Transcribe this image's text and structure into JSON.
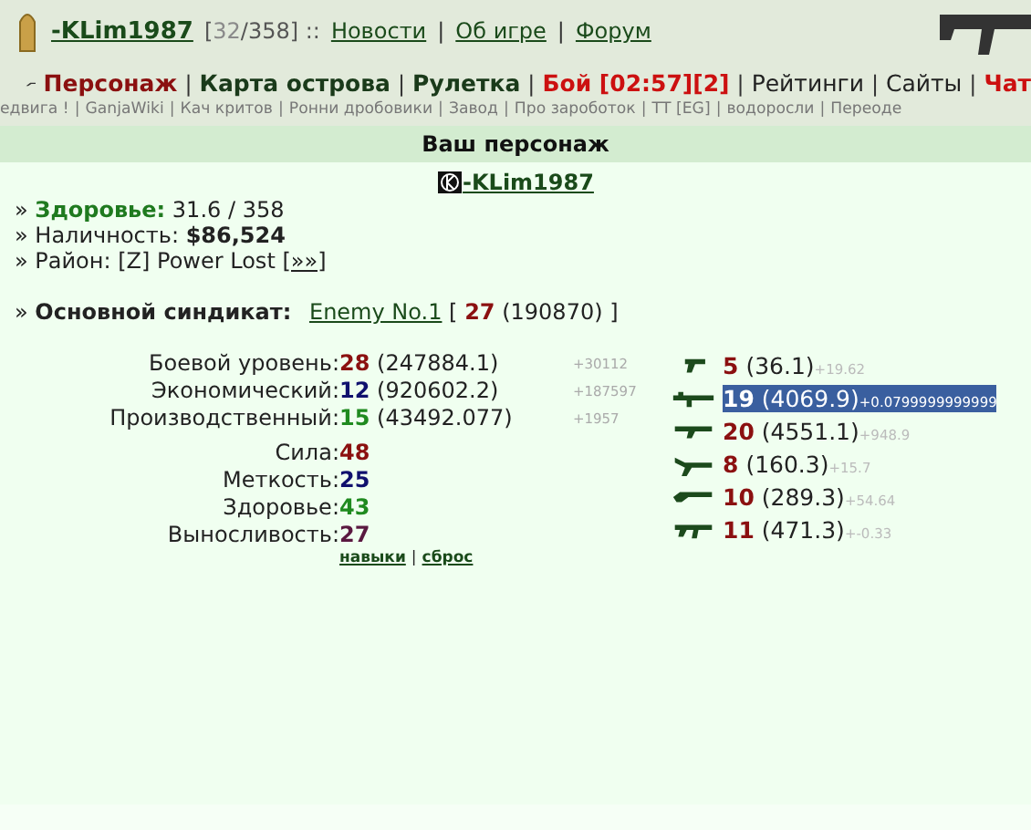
{
  "header": {
    "username": "-KLim1987",
    "hp_open": "[",
    "hp_current": "32",
    "hp_rest": "/358] ::",
    "links": [
      "Новости",
      "Об игре",
      "Форум"
    ],
    "separators": [
      "|",
      "|"
    ]
  },
  "nav_separators": [
    "|",
    "|",
    "|",
    "|",
    "|",
    "|"
  ],
  "sub_separators": [
    "|",
    "|",
    "|",
    "|",
    "|",
    "|",
    "|",
    "|"
  ],
  "bullets": [
    "»",
    "»",
    "»",
    "»"
  ],
  "nav": [
    {
      "label": "Персонаж",
      "kind": "active"
    },
    {
      "label": "Карта острова",
      "kind": "main"
    },
    {
      "label": "Рулетка",
      "kind": "main"
    },
    {
      "label": "Бой [02:57][2]",
      "kind": "alert"
    },
    {
      "label": "Рейтинги",
      "kind": "plain"
    },
    {
      "label": "Сайты",
      "kind": "plain"
    },
    {
      "label": "Чат",
      "kind": "alert"
    }
  ],
  "sublinks": [
    "едвига !",
    "GanjaWiki",
    "Кач критов",
    "Ронни дробовики",
    "Завод",
    "Про зароботок",
    "ТТ [EG]",
    "водоросли",
    "Переоде"
  ],
  "section_title": "Ваш персонаж",
  "character": {
    "name": "-KLim1987",
    "health_label": "Здоровье:",
    "health": "31.6 / 358",
    "cash_label": "Наличность:",
    "cash": "$86,524",
    "district_label": "Район:",
    "district": "[Z] Power Lost",
    "district_link": "[»»]",
    "syndicate_label": "Основной синдикат:",
    "syndicate": "Enemy No.1",
    "syndicate_open": "[",
    "syndicate_level": "27",
    "syndicate_points": "(190870) ]"
  },
  "levels": [
    {
      "label": "Боевой уровень:",
      "value": "28",
      "points": "(247884.1)",
      "delta": "+30112",
      "color": "#8b1010"
    },
    {
      "label": "Экономический:",
      "value": "12",
      "points": "(920602.2)",
      "delta": "+187597",
      "color": "#10106e"
    },
    {
      "label": "Производственный:",
      "value": "15",
      "points": "(43492.077)",
      "delta": "+1957",
      "color": "#1f8a1f"
    }
  ],
  "skills": [
    {
      "label": "Сила:",
      "value": "48",
      "color": "#8b1010"
    },
    {
      "label": "Меткость:",
      "value": "25",
      "color": "#10106e"
    },
    {
      "label": "Здоровье:",
      "value": "43",
      "color": "#1f8a1f"
    },
    {
      "label": "Выносливость:",
      "value": "27",
      "color": "#5a1840"
    }
  ],
  "skill_links": [
    "навыки",
    "сброс"
  ],
  "skill_separator": "|",
  "weapons": [
    {
      "kind": "pistol",
      "level": "5",
      "points": "(36.1)",
      "delta": "+19.62",
      "selected": false
    },
    {
      "kind": "launcher",
      "level": "19",
      "points": "(4069.9)",
      "delta": "+0.0799999999999",
      "selected": true
    },
    {
      "kind": "machinegun",
      "level": "20",
      "points": "(4551.1)",
      "delta": "+948.9",
      "selected": false
    },
    {
      "kind": "rifle",
      "level": "8",
      "points": "(160.3)",
      "delta": "+15.7",
      "selected": false
    },
    {
      "kind": "shotgun",
      "level": "10",
      "points": "(289.3)",
      "delta": "+54.64",
      "selected": false
    },
    {
      "kind": "smg",
      "level": "11",
      "points": "(471.3)",
      "delta": "+-0.33",
      "selected": false
    }
  ]
}
